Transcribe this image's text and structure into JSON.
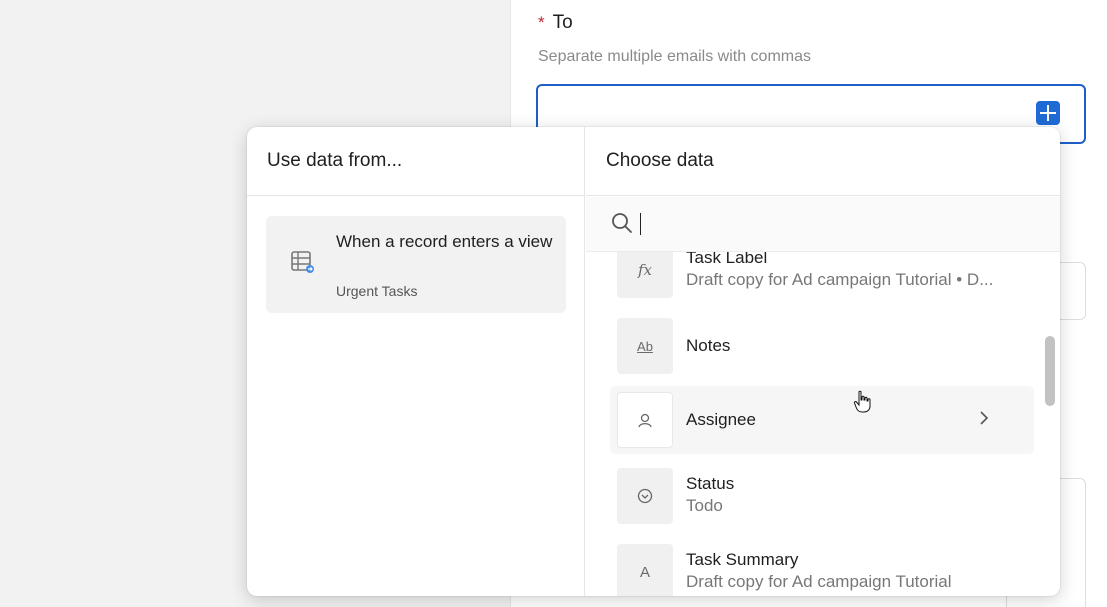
{
  "form": {
    "to_required_mark": "*",
    "to_label": "To",
    "to_hint": "Separate multiple emails with commas"
  },
  "popover": {
    "left_title": "Use data from...",
    "right_title": "Choose data",
    "source": {
      "icon": "table-view-icon",
      "title": "When a record enters a view",
      "subtitle": "Urgent Tasks"
    },
    "search": {
      "value": "",
      "icon": "search-icon"
    },
    "items": [
      {
        "name": "field-task-label",
        "icon": "formula-icon",
        "glyph": "fx",
        "title": "Task Label",
        "subtitle": "Draft copy for Ad campaign Tutorial • D..."
      },
      {
        "name": "field-notes",
        "icon": "long-text-icon",
        "glyph": "Ab",
        "title": "Notes",
        "subtitle": ""
      },
      {
        "name": "field-assignee",
        "icon": "user-icon",
        "glyph": "",
        "title": "Assignee",
        "subtitle": ""
      },
      {
        "name": "field-status",
        "icon": "single-select-icon",
        "glyph": "",
        "title": "Status",
        "subtitle": "Todo"
      },
      {
        "name": "field-task-summary",
        "icon": "text-icon",
        "glyph": "A",
        "title": "Task Summary",
        "subtitle": "Draft copy for Ad campaign Tutorial"
      }
    ]
  },
  "colors": {
    "accent": "#1f6bd6",
    "required": "#c4262e",
    "panel_bg": "#f2f2f2"
  }
}
